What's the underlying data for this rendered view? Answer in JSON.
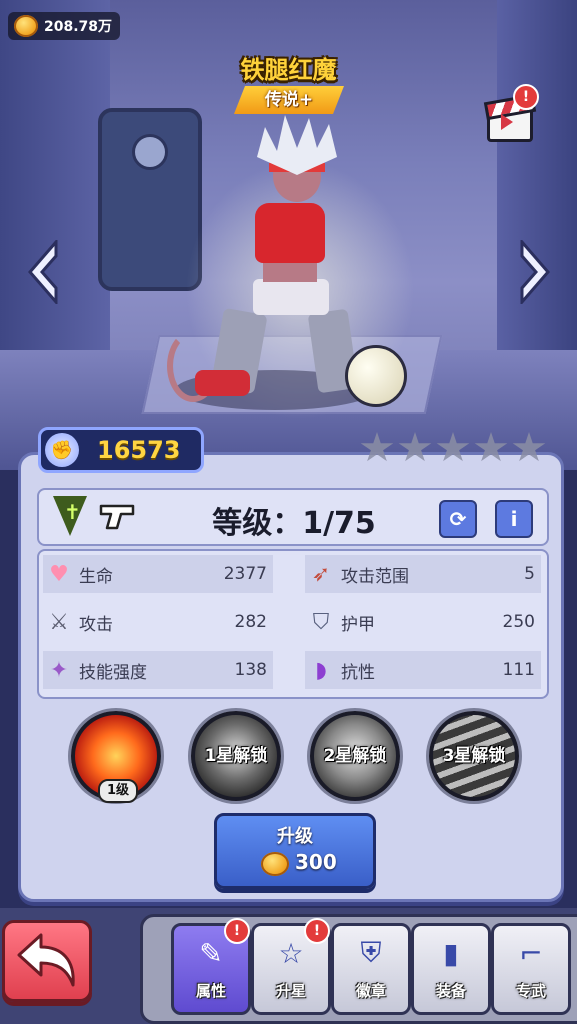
{
  "hud": {
    "currency_value": "208.78万",
    "currency_icon": "gold-coin-icon"
  },
  "hero": {
    "name": "铁腿红魔",
    "rarity": "传说+"
  },
  "power": {
    "value": "16573"
  },
  "stars": {
    "filled": 0,
    "total": 5
  },
  "panel": {
    "level_text": "等级：1/75",
    "stats": [
      {
        "label": "生命",
        "value": "2377",
        "icon": "heart-icon"
      },
      {
        "label": "攻击范围",
        "value": "5",
        "icon": "bow-icon"
      },
      {
        "label": "攻击",
        "value": "282",
        "icon": "sword-icon"
      },
      {
        "label": "护甲",
        "value": "250",
        "icon": "shield-icon"
      },
      {
        "label": "技能强度",
        "value": "138",
        "icon": "wand-icon"
      },
      {
        "label": "抗性",
        "value": "111",
        "icon": "resist-icon"
      }
    ],
    "skills": [
      {
        "label": "",
        "level": "1级",
        "locked": false
      },
      {
        "label": "1星解锁",
        "locked": true
      },
      {
        "label": "2星解锁",
        "locked": true
      },
      {
        "label": "3星解锁",
        "locked": true
      }
    ],
    "info_button": "i",
    "upgrade": {
      "label": "升级",
      "cost": "300"
    }
  },
  "alerts": {
    "badge": "!"
  },
  "tabs": [
    {
      "label": "属性",
      "icon": "attributes-icon",
      "active": true,
      "alert": true
    },
    {
      "label": "升星",
      "icon": "star-up-icon",
      "active": false,
      "alert": true
    },
    {
      "label": "徽章",
      "icon": "badge-icon",
      "active": false,
      "alert": false
    },
    {
      "label": "装备",
      "icon": "ammo-icon",
      "active": false,
      "alert": false
    },
    {
      "label": "专武",
      "icon": "exclusive-weapon-icon",
      "active": false,
      "alert": false
    }
  ],
  "colors": {
    "accent": "#5f8ef2",
    "gold": "#ffd23a",
    "rarity": "#f19a16",
    "alert": "#e33b3b"
  }
}
